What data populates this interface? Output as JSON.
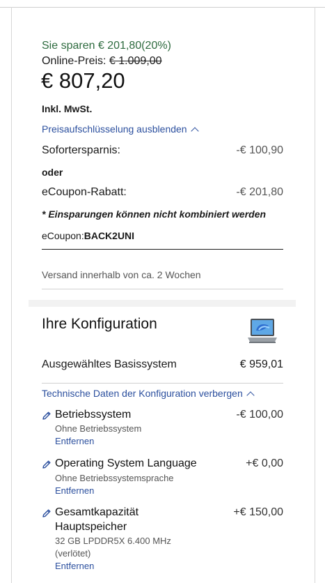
{
  "pricing": {
    "savings_text": "Sie sparen € 201,80(20%)",
    "online_price_label": "Online-Preis:",
    "online_price_old": "€ 1.009,00",
    "current_price": "€ 807,20",
    "vat_label": "Inkl. MwSt.",
    "breakdown_toggle": "Preisaufschlüsselung ausblenden",
    "instant_savings_label": "Sofortersparnis:",
    "instant_savings_value": "-€ 100,90",
    "or_label": "oder",
    "ecoupon_discount_label": "eCoupon-Rabatt:",
    "ecoupon_discount_value": "-€ 201,80",
    "combine_note": "* Einsparungen können nicht kombiniert werden",
    "ecoupon_prefix": "eCoupon:",
    "ecoupon_code": "BACK2UNI",
    "shipping_text": "Versand innerhalb von ca. 2 Wochen"
  },
  "configuration": {
    "title": "Ihre Konfiguration",
    "base_system_label": "Ausgewähltes Basissystem",
    "base_system_price": "€ 959,01",
    "specs_toggle": "Technische Daten der Konfiguration verbergen",
    "options": [
      {
        "title_line1": "Betriebssystem",
        "title_line2": "",
        "subtitle_line1": "Ohne Betriebssystem",
        "subtitle_line2": "",
        "price": "-€ 100,00",
        "remove": "Entfernen"
      },
      {
        "title_line1": "Operating System Language",
        "title_line2": "",
        "subtitle_line1": "Ohne Betriebssystemsprache",
        "subtitle_line2": "",
        "price": "+€ 0,00",
        "remove": "Entfernen"
      },
      {
        "title_line1": "Gesamtkapazität",
        "title_line2": "Hauptspeicher",
        "subtitle_line1": "32 GB LPDDR5X 6.400 MHz",
        "subtitle_line2": "(verlötet)",
        "price": "+€ 150,00",
        "remove": "Entfernen"
      }
    ]
  },
  "icons": {
    "edit": "pencil-icon",
    "toggle": "chevron-up-icon",
    "product": "laptop-icon"
  },
  "colors": {
    "savings": "#2e6b3f",
    "link": "#2b4f9e"
  }
}
